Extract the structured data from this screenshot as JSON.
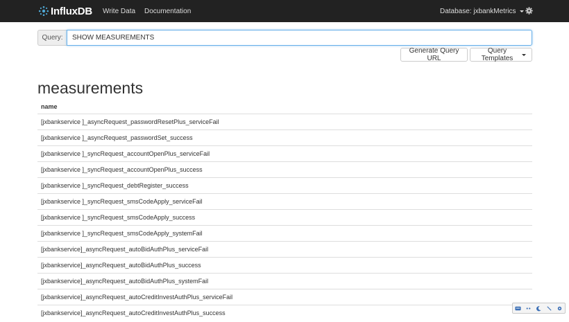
{
  "navbar": {
    "brand": "InfluxDB",
    "links": [
      "Write Data",
      "Documentation"
    ],
    "database_label": "Database: jxbankMetrics"
  },
  "query": {
    "label": "Query:",
    "value": "SHOW MEASUREMENTS"
  },
  "buttons": {
    "generate": "Generate Query URL",
    "templates": "Query Templates"
  },
  "results": {
    "title": "measurements",
    "columns": [
      "name"
    ],
    "rows": [
      "[jxbankservice ]_asyncRequest_passwordResetPlus_serviceFail",
      "[jxbankservice ]_asyncRequest_passwordSet_success",
      "[jxbankservice ]_syncRequest_accountOpenPlus_serviceFail",
      "[jxbankservice ]_syncRequest_accountOpenPlus_success",
      "[jxbankservice ]_syncRequest_debtRegister_success",
      "[jxbankservice ]_syncRequest_smsCodeApply_serviceFail",
      "[jxbankservice ]_syncRequest_smsCodeApply_success",
      "[jxbankservice ]_syncRequest_smsCodeApply_systemFail",
      "[jxbankservice]_asyncRequest_autoBidAuthPlus_serviceFail",
      "[jxbankservice]_asyncRequest_autoBidAuthPlus_success",
      "[jxbankservice]_asyncRequest_autoBidAuthPlus_systemFail",
      "[jxbankservice]_asyncRequest_autoCreditInvestAuthPlus_serviceFail",
      "[jxbankservice]_asyncRequest_autoCreditInvestAuthPlus_success"
    ]
  },
  "colors": {
    "navbar": "#222222",
    "brand_icon": "#4fa8d5",
    "focus": "#66afe9"
  },
  "icons": [
    "influxdb-logo-icon",
    "gear-icon",
    "caret-down-icon"
  ]
}
